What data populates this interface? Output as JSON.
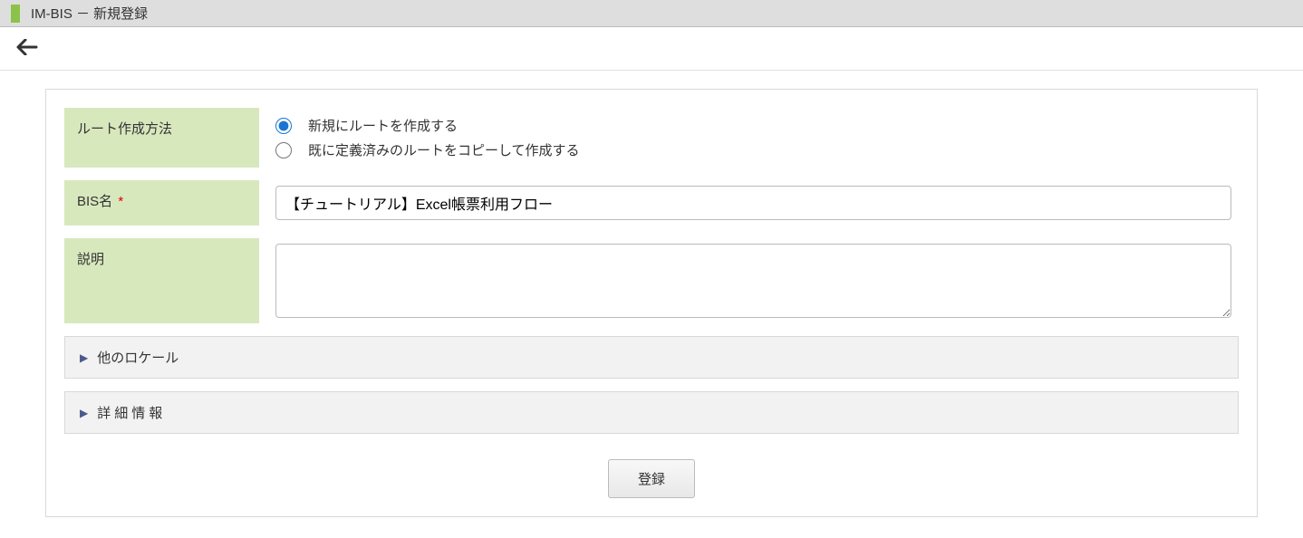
{
  "header": {
    "title": "IM-BIS － 新規登録"
  },
  "form": {
    "fields": {
      "route_method": {
        "label": "ルート作成方法",
        "options": [
          {
            "label": "新規にルートを作成する",
            "value": "new",
            "selected": true
          },
          {
            "label": "既に定義済みのルートをコピーして作成する",
            "value": "copy",
            "selected": false
          }
        ]
      },
      "bis_name": {
        "label": "BIS名",
        "required": true,
        "value": "【チュートリアル】Excel帳票利用フロー"
      },
      "description": {
        "label": "説明",
        "value": ""
      }
    },
    "sections": {
      "other_locales": {
        "label": "他のロケール"
      },
      "detail_info": {
        "label": "詳細情報"
      }
    },
    "buttons": {
      "submit": "登録"
    }
  }
}
